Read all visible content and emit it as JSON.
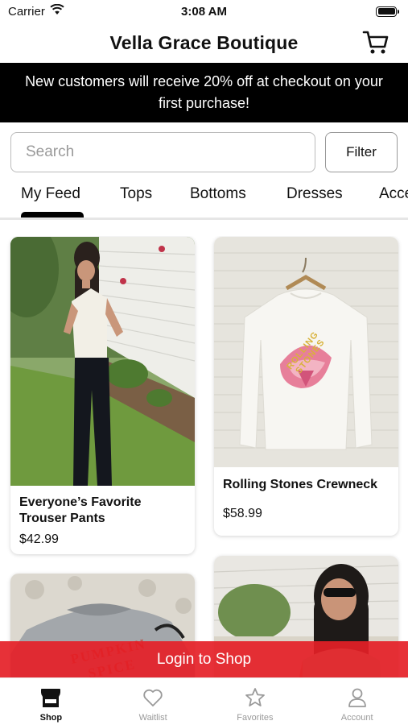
{
  "status_bar": {
    "carrier": "Carrier",
    "time": "3:08 AM"
  },
  "header": {
    "title": "Vella Grace Boutique",
    "cart_icon": "shopping-cart-icon"
  },
  "promo": {
    "text": "New customers will receive 20% off at checkout on your first purchase!"
  },
  "search": {
    "placeholder": "Search",
    "value": "",
    "filter_label": "Filter"
  },
  "tabs": [
    {
      "label": "My Feed",
      "selected": true
    },
    {
      "label": "Tops",
      "selected": false
    },
    {
      "label": "Bottoms",
      "selected": false
    },
    {
      "label": "Dresses",
      "selected": false
    },
    {
      "label": "Acce",
      "selected": false
    }
  ],
  "products": [
    {
      "name": "Everyone’s Favorite Trouser Pants",
      "price": "$42.99"
    },
    {
      "name": "Rolling Stones Crewneck",
      "price": "$58.99"
    },
    {
      "name": "",
      "price": ""
    },
    {
      "name": "",
      "price": ""
    }
  ],
  "graphic_text": {
    "sweatshirt_logo": "ROLLING STONES",
    "pumpkin_shirt": "PUMPKIN SPICE"
  },
  "login_bar": {
    "label": "Login to Shop"
  },
  "bottom_nav": [
    {
      "label": "Shop",
      "icon": "storefront-icon",
      "active": true
    },
    {
      "label": "Waitlist",
      "icon": "heart-icon",
      "active": false
    },
    {
      "label": "Favorites",
      "icon": "star-icon",
      "active": false
    },
    {
      "label": "Account",
      "icon": "person-icon",
      "active": false
    }
  ],
  "colors": {
    "accent_red": "#e52027",
    "promo_bg": "#000000",
    "nav_inactive": "#999999"
  }
}
